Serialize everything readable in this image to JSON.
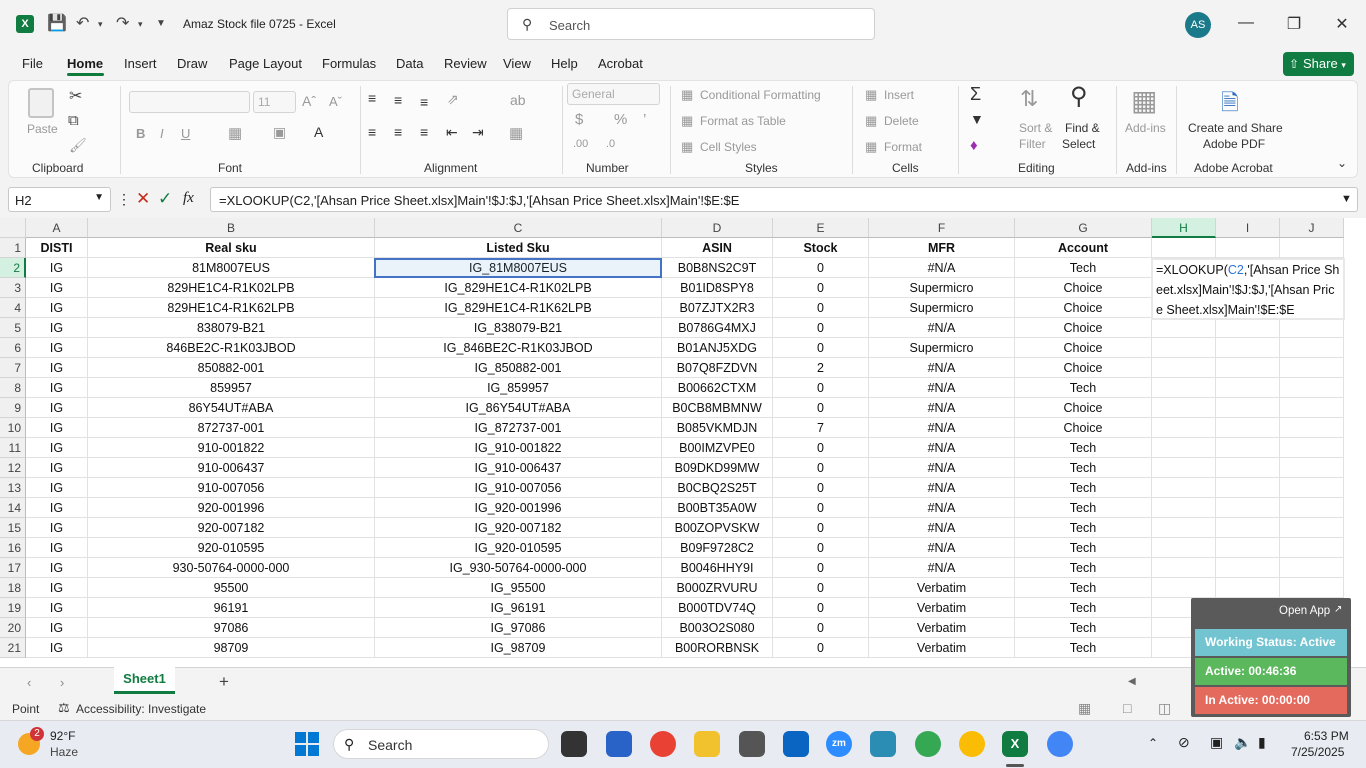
{
  "titlebar": {
    "title": "Amaz Stock file 0725  -  Excel",
    "search_placeholder": "Search",
    "avatar_initials": "AS"
  },
  "menu": {
    "items": [
      "File",
      "Home",
      "Insert",
      "Draw",
      "Page Layout",
      "Formulas",
      "Data",
      "Review",
      "View",
      "Help",
      "Acrobat"
    ],
    "active": "Home",
    "share_label": "Share"
  },
  "ribbon": {
    "clipboard": {
      "paste": "Paste",
      "label": "Clipboard"
    },
    "font": {
      "size": "11",
      "label": "Font"
    },
    "alignment": {
      "label": "Alignment"
    },
    "number": {
      "format": "General",
      "label": "Number"
    },
    "styles": {
      "conditional": "Conditional Formatting",
      "format_table": "Format as Table",
      "cell_styles": "Cell Styles",
      "label": "Styles"
    },
    "cells": {
      "insert": "Insert",
      "delete": "Delete",
      "format": "Format",
      "label": "Cells"
    },
    "editing": {
      "sort1": "Sort &",
      "sort2": "Filter",
      "find1": "Find &",
      "find2": "Select",
      "label": "Editing"
    },
    "addins": {
      "btn": "Add-ins",
      "label": "Add-ins"
    },
    "acrobat": {
      "btn1": "Create and Share",
      "btn2": "Adobe PDF",
      "label": "Adobe Acrobat"
    }
  },
  "formula_bar": {
    "name_box": "H2",
    "formula": "=XLOOKUP(C2,'[Ahsan Price Sheet.xlsx]Main'!$J:$J,'[Ahsan Price Sheet.xlsx]Main'!$E:$E"
  },
  "grid": {
    "columns": [
      "A",
      "B",
      "C",
      "D",
      "E",
      "F",
      "G",
      "H",
      "I",
      "J"
    ],
    "header_row": [
      "DISTI",
      "Real sku",
      "Listed Sku",
      "ASIN",
      "Stock",
      "MFR",
      "Account"
    ],
    "rows": [
      [
        "IG",
        "81M8007EUS",
        "IG_81M8007EUS",
        "B0B8NS2C9T",
        "0",
        "#N/A",
        "Tech"
      ],
      [
        "IG",
        "829HE1C4-R1K02LPB",
        "IG_829HE1C4-R1K02LPB",
        "B01ID8SPY8",
        "0",
        "Supermicro",
        "Choice"
      ],
      [
        "IG",
        "829HE1C4-R1K62LPB",
        "IG_829HE1C4-R1K62LPB",
        "B07ZJTX2R3",
        "0",
        "Supermicro",
        "Choice"
      ],
      [
        "IG",
        "838079-B21",
        "IG_838079-B21",
        "B0786G4MXJ",
        "0",
        "#N/A",
        "Choice"
      ],
      [
        "IG",
        "846BE2C-R1K03JBOD",
        "IG_846BE2C-R1K03JBOD",
        "B01ANJ5XDG",
        "0",
        "Supermicro",
        "Choice"
      ],
      [
        "IG",
        "850882-001",
        "IG_850882-001",
        "B07Q8FZDVN",
        "2",
        "#N/A",
        "Choice"
      ],
      [
        "IG",
        "859957",
        "IG_859957",
        "B00662CTXM",
        "0",
        "#N/A",
        "Tech"
      ],
      [
        "IG",
        "86Y54UT#ABA",
        "IG_86Y54UT#ABA",
        "B0CB8MBMNW",
        "0",
        "#N/A",
        "Choice"
      ],
      [
        "IG",
        "872737-001",
        "IG_872737-001",
        "B085VKMDJN",
        "7",
        "#N/A",
        "Choice"
      ],
      [
        "IG",
        "910-001822",
        "IG_910-001822",
        "B00IMZVPE0",
        "0",
        "#N/A",
        "Tech"
      ],
      [
        "IG",
        "910-006437",
        "IG_910-006437",
        "B09DKD99MW",
        "0",
        "#N/A",
        "Tech"
      ],
      [
        "IG",
        "910-007056",
        "IG_910-007056",
        "B0CBQ2S25T",
        "0",
        "#N/A",
        "Tech"
      ],
      [
        "IG",
        "920-001996",
        "IG_920-001996",
        "B00BT35A0W",
        "0",
        "#N/A",
        "Tech"
      ],
      [
        "IG",
        "920-007182",
        "IG_920-007182",
        "B00ZOPVSKW",
        "0",
        "#N/A",
        "Tech"
      ],
      [
        "IG",
        "920-010595",
        "IG_920-010595",
        "B09F9728C2",
        "0",
        "#N/A",
        "Tech"
      ],
      [
        "IG",
        "930-50764-0000-000",
        "IG_930-50764-0000-000",
        "B0046HHY9I",
        "0",
        "#N/A",
        "Tech"
      ],
      [
        "IG",
        "95500",
        "IG_95500",
        "B000ZRVURU",
        "0",
        "Verbatim",
        "Tech"
      ],
      [
        "IG",
        "96191",
        "IG_96191",
        "B000TDV74Q",
        "0",
        "Verbatim",
        "Tech"
      ],
      [
        "IG",
        "97086",
        "IG_97086",
        "B003O2S080",
        "0",
        "Verbatim",
        "Tech"
      ],
      [
        "IG",
        "98709",
        "IG_98709",
        "B00RORBNSK",
        "0",
        "Verbatim",
        "Tech"
      ]
    ],
    "edit_parts": [
      "=XLOOKUP(",
      "C2",
      ",'[Ahsan Price Sheet.xlsx]Main'!$J:$J,'[Ahsan Price Sheet.xlsx]Main'!$E:$E"
    ]
  },
  "sheet_tabs": {
    "active": "Sheet1"
  },
  "status": {
    "mode": "Point",
    "accessibility": "Accessibility: Investigate"
  },
  "overlay": {
    "open_app": "Open App",
    "working": "Working Status: Active",
    "active": "Active: 00:46:36",
    "inactive": "In Active: 00:00:00"
  },
  "taskbar": {
    "weather_badge": "2",
    "temp": "92°F",
    "condition": "Haze",
    "search": "Search",
    "time": "6:53 PM",
    "date": "7/25/2025"
  },
  "colors": {
    "excel_green": "#107c41",
    "selection": "#4472c4"
  }
}
